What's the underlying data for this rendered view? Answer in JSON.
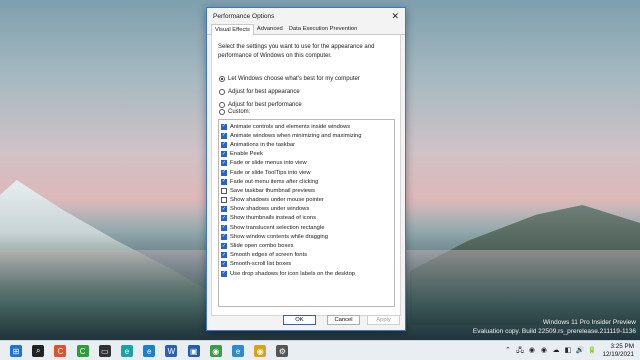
{
  "window": {
    "title": "Performance Options",
    "close_glyph": "✕"
  },
  "tabs": [
    {
      "label": "Visual Effects",
      "active": true
    },
    {
      "label": "Advanced",
      "active": false
    },
    {
      "label": "Data Execution Prevention",
      "active": false
    }
  ],
  "panel": {
    "description": "Select the settings you want to use for the appearance and performance of Windows on this computer.",
    "radios": [
      {
        "label": "Let Windows choose what's best for my computer",
        "selected": true
      },
      {
        "label": "Adjust for best appearance",
        "selected": false
      },
      {
        "label": "Adjust for best performance",
        "selected": false
      },
      {
        "label": "Custom:",
        "selected": false
      }
    ],
    "options": [
      {
        "label": "Animate controls and elements inside windows",
        "checked": true
      },
      {
        "label": "Animate windows when minimizing and maximizing",
        "checked": true
      },
      {
        "label": "Animations in the taskbar",
        "checked": true
      },
      {
        "label": "Enable Peek",
        "checked": true
      },
      {
        "label": "Fade or slide menus into view",
        "checked": true
      },
      {
        "label": "Fade or slide ToolTips into view",
        "checked": true
      },
      {
        "label": "Fade out menu items after clicking",
        "checked": true
      },
      {
        "label": "Save taskbar thumbnail previews",
        "checked": false
      },
      {
        "label": "Show shadows under mouse pointer",
        "checked": false
      },
      {
        "label": "Show shadows under windows",
        "checked": true
      },
      {
        "label": "Show thumbnails instead of icons",
        "checked": true
      },
      {
        "label": "Show translucent selection rectangle",
        "checked": true
      },
      {
        "label": "Show window contents while dragging",
        "checked": true
      },
      {
        "label": "Slide open combo boxes",
        "checked": true
      },
      {
        "label": "Smooth edges of screen fonts",
        "checked": true
      },
      {
        "label": "Smooth-scroll list boxes",
        "checked": true
      },
      {
        "label": "Use drop shadows for icon labels on the desktop",
        "checked": true
      }
    ]
  },
  "buttons": {
    "ok": "OK",
    "cancel": "Cancel",
    "apply": "Apply"
  },
  "watermark": {
    "line1": "Windows 11 Pro Insider Preview",
    "line2": "Evaluation copy. Build 22509.rs_prerelease.211119-1136"
  },
  "taskbar": {
    "icons": [
      {
        "name": "start-icon",
        "color": "#1a73d9"
      },
      {
        "name": "search-icon",
        "color": "#222222"
      },
      {
        "name": "app-c-icon",
        "color": "#e0502a"
      },
      {
        "name": "app-c-green-icon",
        "color": "#2e9c3a"
      },
      {
        "name": "file-explorer-icon",
        "color": "#333333"
      },
      {
        "name": "edge-icon",
        "color": "#1aa3a3"
      },
      {
        "name": "edge-beta-icon",
        "color": "#1b7fd0"
      },
      {
        "name": "word-icon",
        "color": "#2b5eb8"
      },
      {
        "name": "app-blue-icon",
        "color": "#1f5fa8"
      },
      {
        "name": "chrome-icon",
        "color": "#3c9b46"
      },
      {
        "name": "edge-dev-icon",
        "color": "#2a8bd0"
      },
      {
        "name": "chrome-canary-icon",
        "color": "#d9a21b"
      },
      {
        "name": "settings-icon",
        "color": "#555555"
      }
    ],
    "tray_glyphs": [
      "⌃",
      "🖧",
      "◉",
      "◉",
      "☁",
      "◧",
      "🔊",
      "🔋"
    ],
    "time": "3:25 PM",
    "date": "12/19/2021"
  }
}
